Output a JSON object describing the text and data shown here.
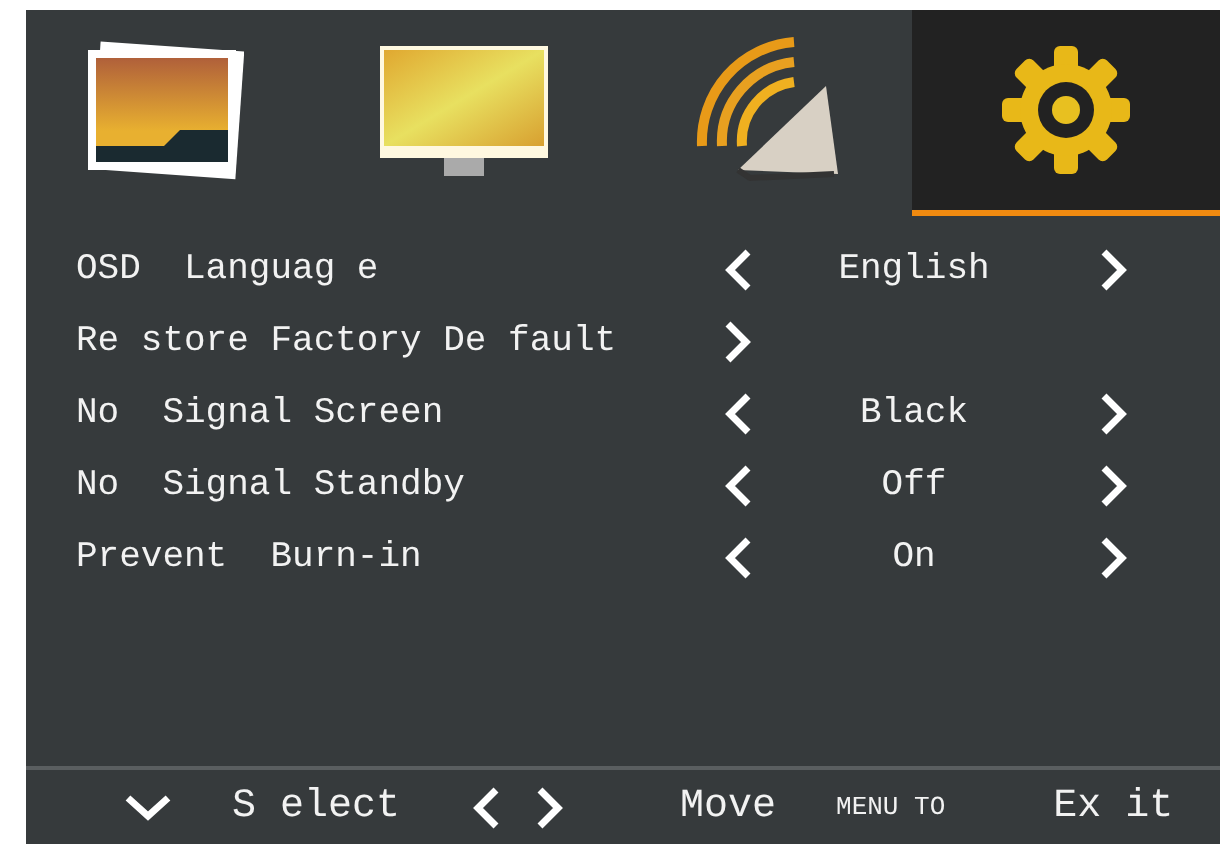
{
  "tabs": [
    {
      "kind": "photo",
      "selected": false
    },
    {
      "kind": "picture",
      "selected": false
    },
    {
      "kind": "sound",
      "selected": false
    },
    {
      "kind": "settings",
      "selected": true
    }
  ],
  "menu": [
    {
      "kind": "option",
      "label": "OSD  Languag e",
      "value": "English"
    },
    {
      "kind": "action",
      "label": "Re store Factory De fault"
    },
    {
      "kind": "option",
      "label": "No  Signal Screen",
      "value": "Black"
    },
    {
      "kind": "option",
      "label": "No  Signal Standby",
      "value": "Off"
    },
    {
      "kind": "option",
      "label": "Prevent  Burn-in",
      "value": "On"
    }
  ],
  "footer": {
    "select": "S elect",
    "move": "Move",
    "menu_to": "MENU TO",
    "exit": "Ex it"
  }
}
